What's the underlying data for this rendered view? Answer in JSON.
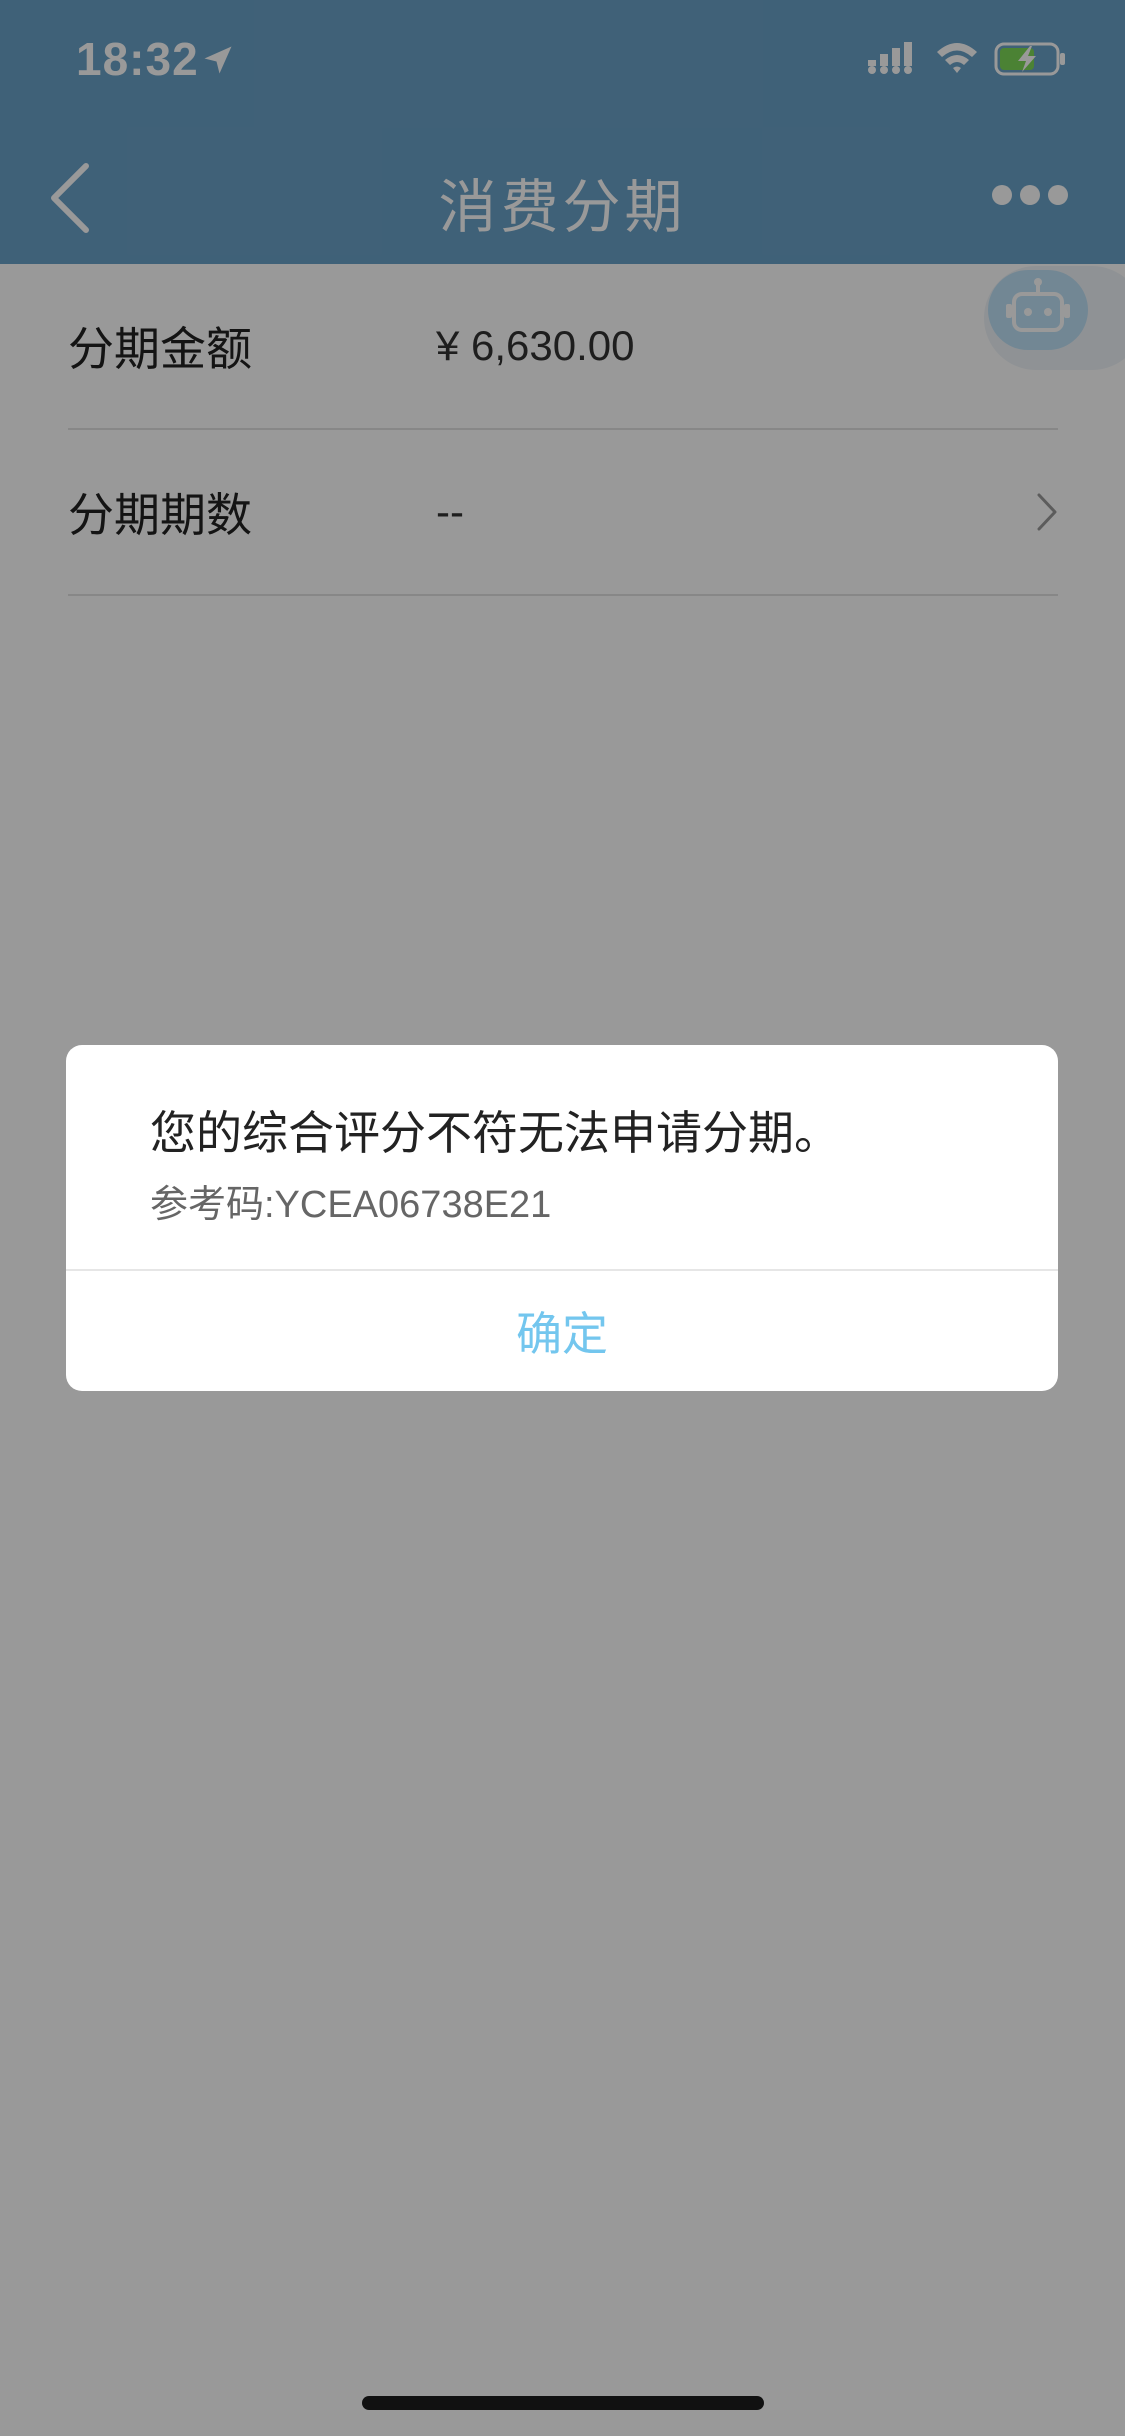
{
  "status_bar": {
    "time": "18:32",
    "icons": [
      "location-arrow-icon",
      "signal-icon",
      "wifi-icon",
      "battery-charging-icon"
    ]
  },
  "nav": {
    "title": "消费分期",
    "back_icon": "chevron-left-icon",
    "more_icon": "more-dots-icon"
  },
  "floating": {
    "icon": "robot-icon"
  },
  "form": {
    "rows": [
      {
        "label": "分期金额",
        "value": "¥ 6,630.00"
      },
      {
        "label": "分期期数",
        "value": "--",
        "icon": "chevron-right-icon"
      }
    ]
  },
  "dialog": {
    "message": "您的综合评分不符无法申请分期。",
    "reference": "参考码:YCEA06738E21",
    "confirm_label": "确定"
  },
  "colors": {
    "header": "#6aa2c8",
    "confirm": "#73c6ee"
  }
}
